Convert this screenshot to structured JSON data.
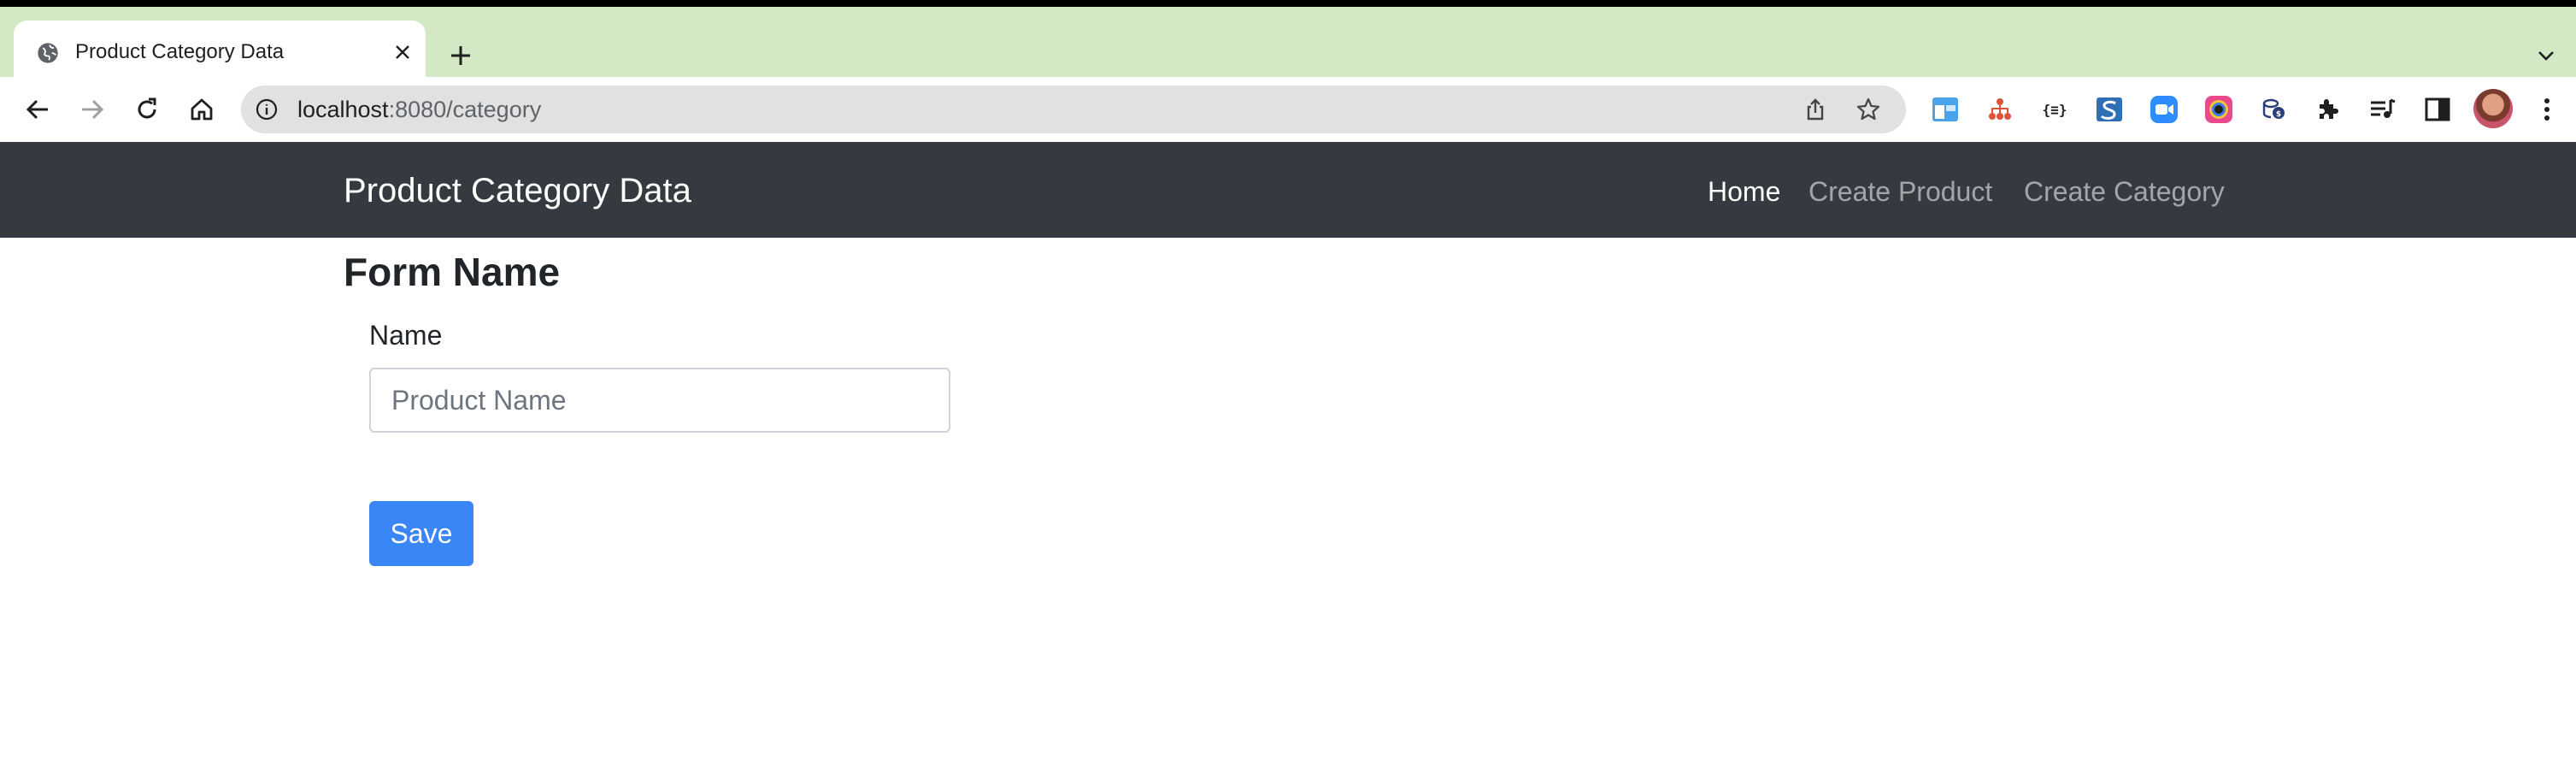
{
  "browser": {
    "tab": {
      "title": "Product Category Data",
      "favicon": "globe-icon"
    },
    "address_bar": {
      "host": "localhost",
      "path": ":8080/category"
    },
    "accent_color": "#d3e8c4"
  },
  "navbar": {
    "brand": "Product Category Data",
    "links": [
      {
        "label": "Home",
        "active": true
      },
      {
        "label": "Create Product",
        "active": false
      },
      {
        "label": "Create Category",
        "active": false
      }
    ],
    "background": "#343a40"
  },
  "form": {
    "title": "Form Name",
    "name_label": "Name",
    "name_placeholder": "Product Name",
    "name_value": "",
    "save_label": "Save",
    "save_color": "#3a86f7"
  }
}
